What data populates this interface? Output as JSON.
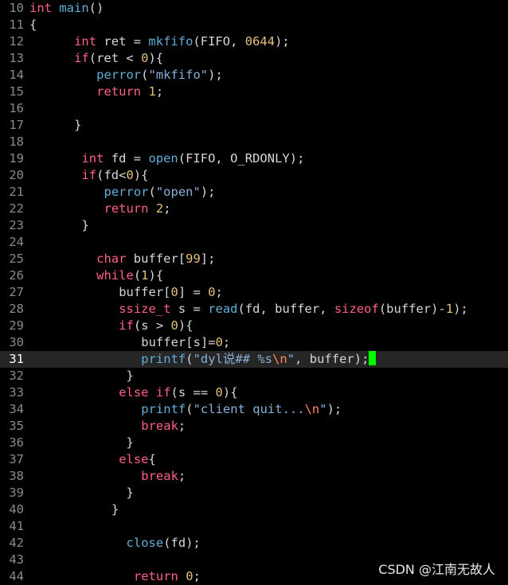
{
  "editor": {
    "current_line": 31,
    "lines": [
      {
        "n": "10",
        "indent": 0,
        "tokens": [
          [
            "int",
            "type"
          ],
          [
            " ",
            "id"
          ],
          [
            "main",
            "fn"
          ],
          [
            "()",
            "id"
          ]
        ]
      },
      {
        "n": "11",
        "indent": 0,
        "tokens": [
          [
            "{",
            "id"
          ]
        ]
      },
      {
        "n": "12",
        "indent": 6,
        "tokens": [
          [
            "int",
            "type"
          ],
          [
            " ret = ",
            "id"
          ],
          [
            "mkfifo",
            "fn"
          ],
          [
            "(FIFO, ",
            "id"
          ],
          [
            "0644",
            "num"
          ],
          [
            ");",
            "id"
          ]
        ]
      },
      {
        "n": "13",
        "indent": 6,
        "tokens": [
          [
            "if",
            "kw"
          ],
          [
            "(ret < ",
            "id"
          ],
          [
            "0",
            "num"
          ],
          [
            "){",
            "id"
          ]
        ]
      },
      {
        "n": "14",
        "indent": 9,
        "tokens": [
          [
            "perror",
            "fn"
          ],
          [
            "(",
            "id"
          ],
          [
            "\"mkfifo\"",
            "str"
          ],
          [
            ");",
            "id"
          ]
        ]
      },
      {
        "n": "15",
        "indent": 9,
        "tokens": [
          [
            "return",
            "kw"
          ],
          [
            " ",
            "id"
          ],
          [
            "1",
            "num"
          ],
          [
            ";",
            "id"
          ]
        ]
      },
      {
        "n": "16",
        "indent": 0,
        "tokens": []
      },
      {
        "n": "17",
        "indent": 6,
        "tokens": [
          [
            "}",
            "id"
          ]
        ]
      },
      {
        "n": "18",
        "indent": 0,
        "tokens": []
      },
      {
        "n": "19",
        "indent": 7,
        "tokens": [
          [
            "int",
            "type"
          ],
          [
            " fd = ",
            "id"
          ],
          [
            "open",
            "fn"
          ],
          [
            "(FIFO, O_RDONLY);",
            "id"
          ]
        ]
      },
      {
        "n": "20",
        "indent": 7,
        "tokens": [
          [
            "if",
            "kw"
          ],
          [
            "(fd<",
            "id"
          ],
          [
            "0",
            "num"
          ],
          [
            "){",
            "id"
          ]
        ]
      },
      {
        "n": "21",
        "indent": 10,
        "tokens": [
          [
            "perror",
            "fn"
          ],
          [
            "(",
            "id"
          ],
          [
            "\"open\"",
            "str"
          ],
          [
            ");",
            "id"
          ]
        ]
      },
      {
        "n": "22",
        "indent": 10,
        "tokens": [
          [
            "return",
            "kw"
          ],
          [
            " ",
            "id"
          ],
          [
            "2",
            "num"
          ],
          [
            ";",
            "id"
          ]
        ]
      },
      {
        "n": "23",
        "indent": 7,
        "tokens": [
          [
            "}",
            "id"
          ]
        ]
      },
      {
        "n": "24",
        "indent": 0,
        "tokens": []
      },
      {
        "n": "25",
        "indent": 9,
        "tokens": [
          [
            "char",
            "type"
          ],
          [
            " buffer[",
            "id"
          ],
          [
            "99",
            "num"
          ],
          [
            "];",
            "id"
          ]
        ]
      },
      {
        "n": "26",
        "indent": 9,
        "tokens": [
          [
            "while",
            "kw"
          ],
          [
            "(",
            "id"
          ],
          [
            "1",
            "num"
          ],
          [
            "){",
            "id"
          ]
        ]
      },
      {
        "n": "27",
        "indent": 12,
        "tokens": [
          [
            "buffer[",
            "id"
          ],
          [
            "0",
            "num"
          ],
          [
            "] = ",
            "id"
          ],
          [
            "0",
            "num"
          ],
          [
            ";",
            "id"
          ]
        ]
      },
      {
        "n": "28",
        "indent": 12,
        "tokens": [
          [
            "ssize_t",
            "type"
          ],
          [
            " s = ",
            "id"
          ],
          [
            "read",
            "fn"
          ],
          [
            "(fd, buffer, ",
            "id"
          ],
          [
            "sizeof",
            "kw"
          ],
          [
            "(buffer)-",
            "id"
          ],
          [
            "1",
            "num"
          ],
          [
            ");",
            "id"
          ]
        ]
      },
      {
        "n": "29",
        "indent": 12,
        "tokens": [
          [
            "if",
            "kw"
          ],
          [
            "(s > ",
            "id"
          ],
          [
            "0",
            "num"
          ],
          [
            "){",
            "id"
          ]
        ]
      },
      {
        "n": "30",
        "indent": 15,
        "tokens": [
          [
            "buffer[s]=",
            "id"
          ],
          [
            "0",
            "num"
          ],
          [
            ";",
            "id"
          ]
        ]
      },
      {
        "n": "31",
        "indent": 15,
        "cursor": true,
        "tokens": [
          [
            "printf",
            "fn"
          ],
          [
            "(",
            "id"
          ],
          [
            "\"dyl说## %s",
            "str"
          ],
          [
            "\\n",
            "esc"
          ],
          [
            "\"",
            "str"
          ],
          [
            ", buffer);",
            "id"
          ]
        ]
      },
      {
        "n": "32",
        "indent": 13,
        "tokens": [
          [
            "}",
            "id"
          ]
        ]
      },
      {
        "n": "33",
        "indent": 12,
        "tokens": [
          [
            "else",
            "kw"
          ],
          [
            " ",
            "id"
          ],
          [
            "if",
            "kw"
          ],
          [
            "(s == ",
            "id"
          ],
          [
            "0",
            "num"
          ],
          [
            "){",
            "id"
          ]
        ]
      },
      {
        "n": "34",
        "indent": 15,
        "tokens": [
          [
            "printf",
            "fn"
          ],
          [
            "(",
            "id"
          ],
          [
            "\"client quit...",
            "str"
          ],
          [
            "\\n",
            "esc"
          ],
          [
            "\"",
            "str"
          ],
          [
            ");",
            "id"
          ]
        ]
      },
      {
        "n": "35",
        "indent": 15,
        "tokens": [
          [
            "break",
            "kw"
          ],
          [
            ";",
            "id"
          ]
        ]
      },
      {
        "n": "36",
        "indent": 13,
        "tokens": [
          [
            "}",
            "id"
          ]
        ]
      },
      {
        "n": "37",
        "indent": 12,
        "tokens": [
          [
            "else",
            "kw"
          ],
          [
            "{",
            "id"
          ]
        ]
      },
      {
        "n": "38",
        "indent": 15,
        "tokens": [
          [
            "break",
            "kw"
          ],
          [
            ";",
            "id"
          ]
        ]
      },
      {
        "n": "39",
        "indent": 13,
        "tokens": [
          [
            "}",
            "id"
          ]
        ]
      },
      {
        "n": "40",
        "indent": 11,
        "tokens": [
          [
            "}",
            "id"
          ]
        ]
      },
      {
        "n": "41",
        "indent": 0,
        "tokens": []
      },
      {
        "n": "42",
        "indent": 13,
        "tokens": [
          [
            "close",
            "fn"
          ],
          [
            "(fd);",
            "id"
          ]
        ]
      },
      {
        "n": "43",
        "indent": 0,
        "tokens": []
      },
      {
        "n": "44",
        "indent": 14,
        "tokens": [
          [
            "return",
            "kw"
          ],
          [
            " ",
            "id"
          ],
          [
            "0",
            "num"
          ],
          [
            ";",
            "id"
          ]
        ]
      }
    ]
  },
  "watermark": {
    "text": "CSDN @江南无故人"
  },
  "colors": {
    "background": "#000000",
    "line_number": "#8a8a8a",
    "keyword": "#ff5f87",
    "function": "#5fafd7",
    "number": "#e5c07b",
    "string": "#87afd7",
    "escape": "#ff875f",
    "cursor": "#00ff00",
    "current_line_bg": "#262626"
  }
}
